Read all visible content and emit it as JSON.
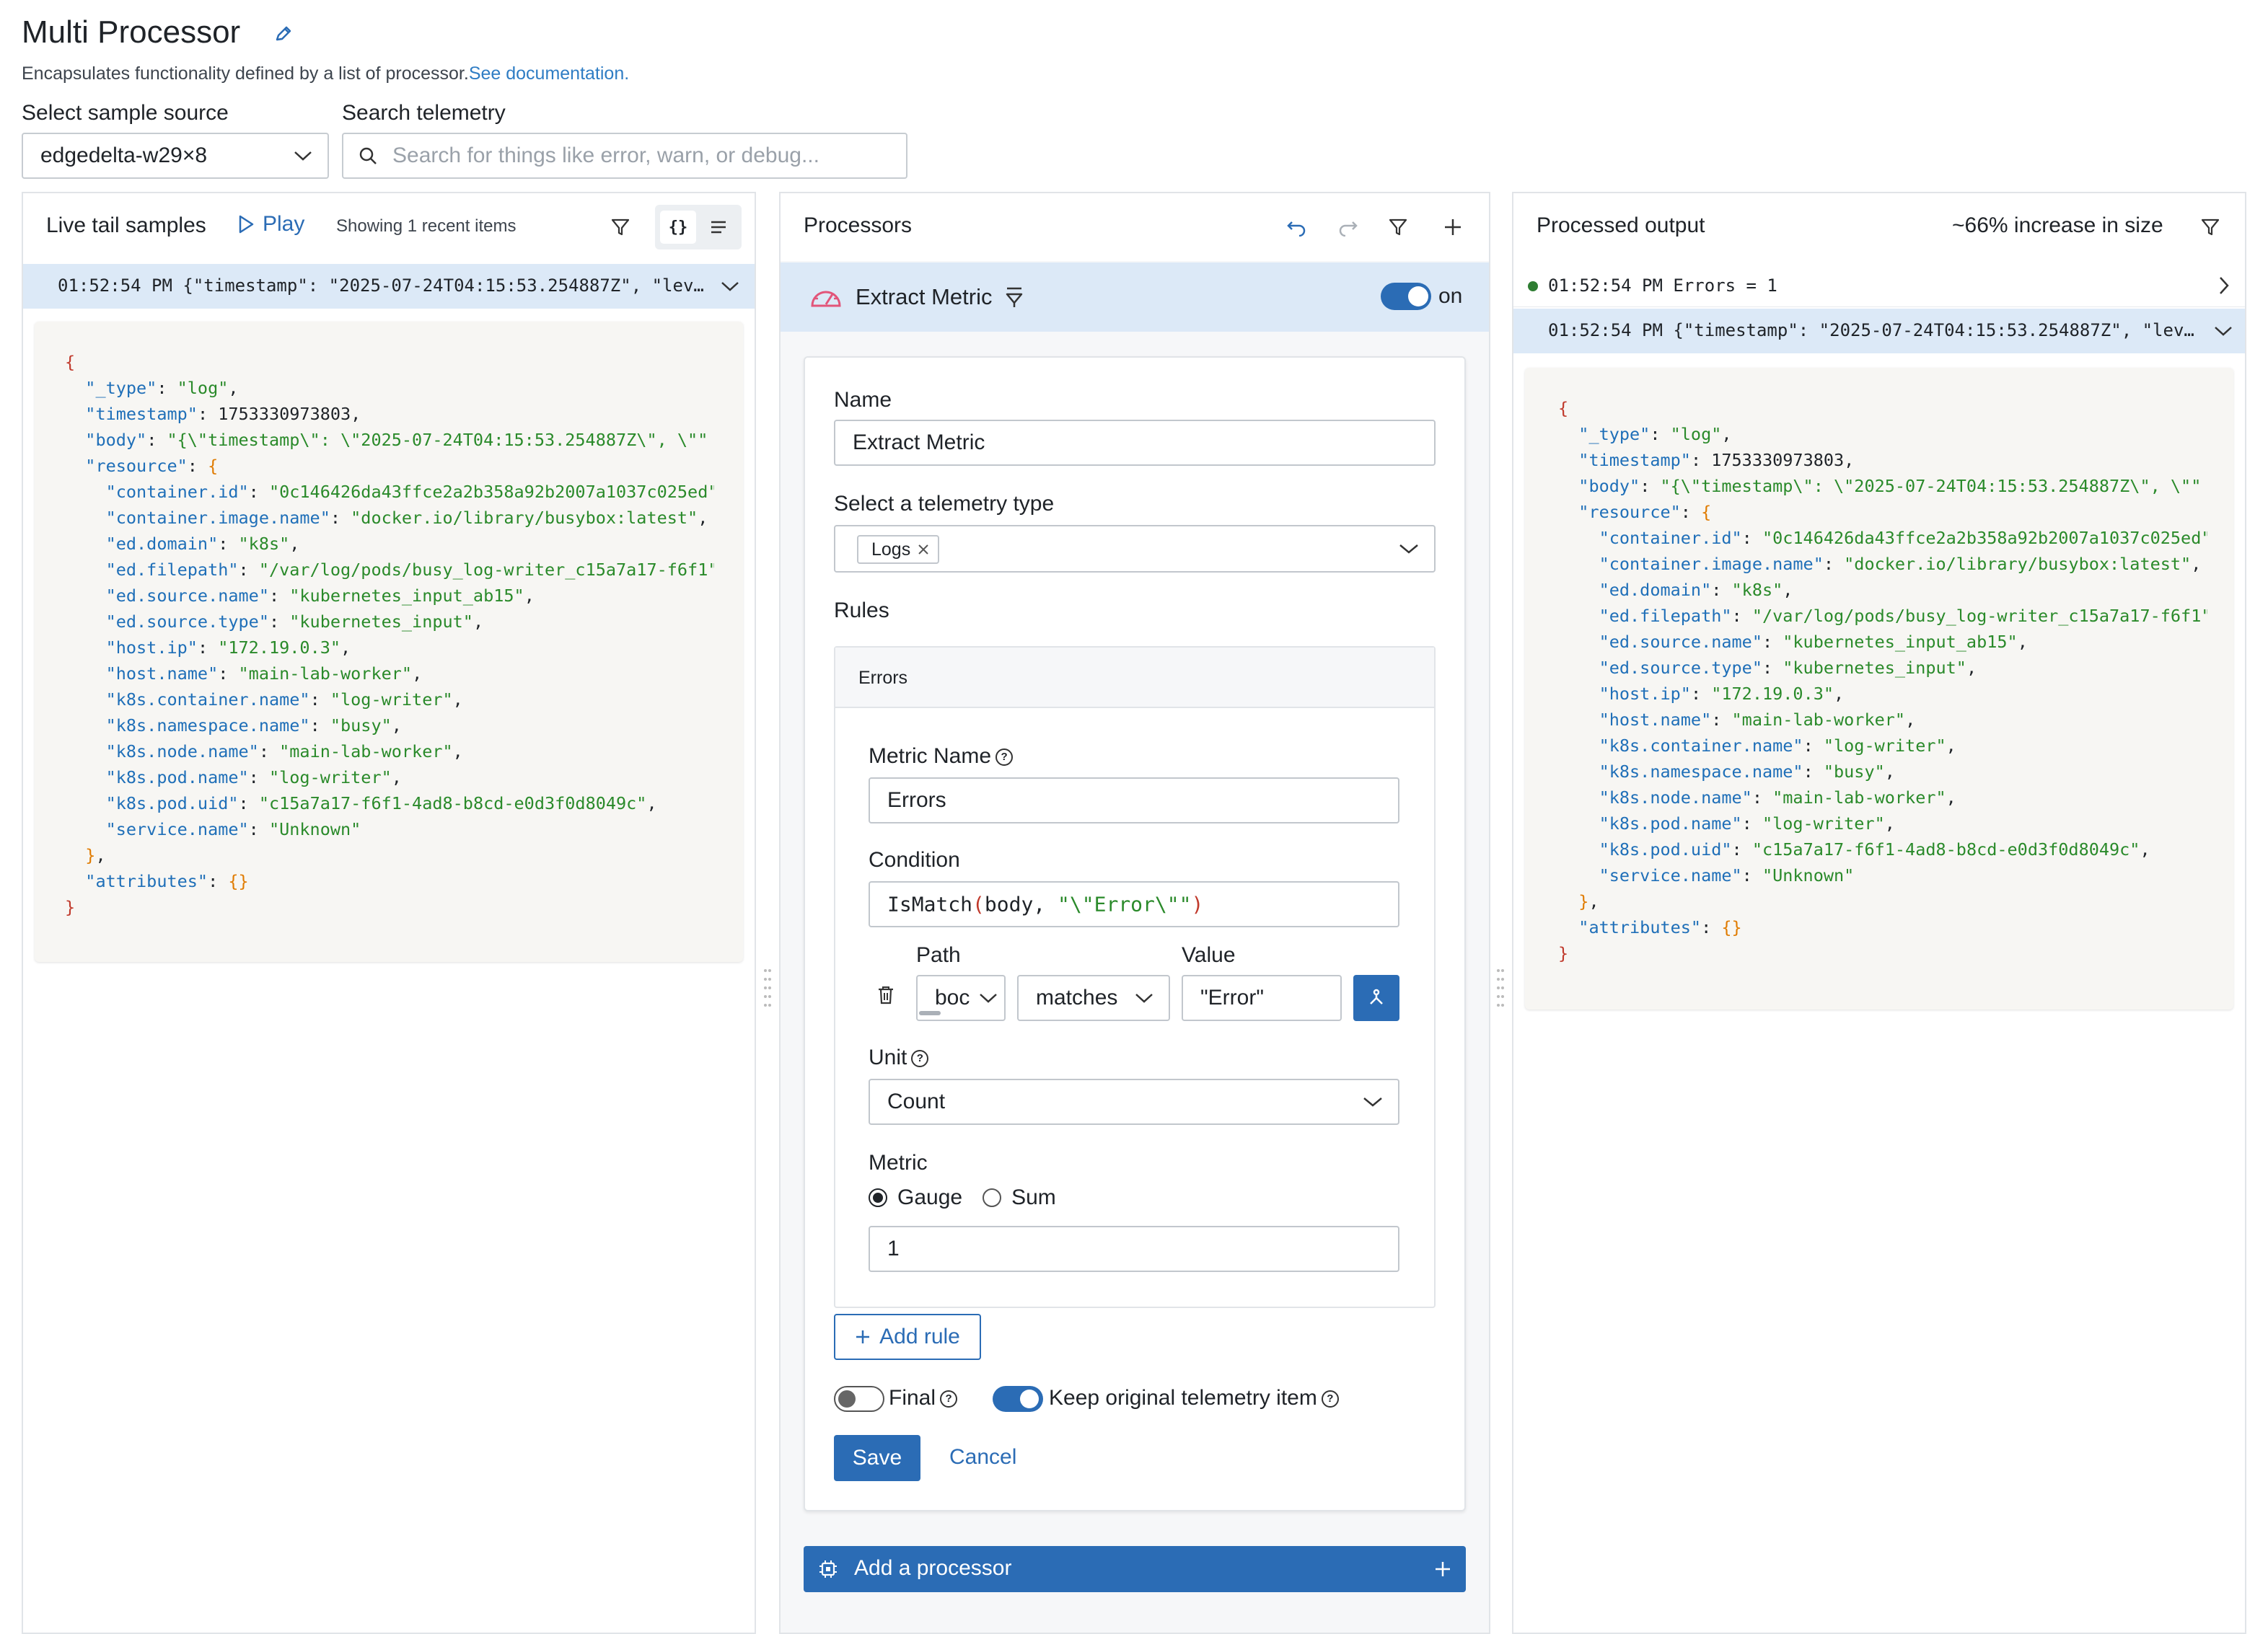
{
  "header": {
    "title": "Multi Processor",
    "subtitle": "Encapsulates functionality defined by a list of processor.",
    "doc_link": "See documentation.",
    "sample_source_label": "Select sample source",
    "sample_source_value": "edgedelta-w29×8",
    "search_label": "Search telemetry",
    "search_placeholder": "Search for things like error, warn, or debug..."
  },
  "live_tail": {
    "title": "Live tail samples",
    "play_label": "Play",
    "showing_text": "Showing 1 recent items",
    "log_line": "01:52:54 PM {\"timestamp\": \"2025-07-24T04:15:53.254887Z\", \"lev…",
    "json_lines": [
      [
        {
          "t": "b",
          "v": "{"
        }
      ],
      [
        {
          "t": "n",
          "v": "  "
        },
        {
          "t": "k",
          "v": "\"_type\""
        },
        {
          "t": "n",
          "v": ": "
        },
        {
          "t": "s",
          "v": "\"log\""
        },
        {
          "t": "n",
          "v": ","
        }
      ],
      [
        {
          "t": "n",
          "v": "  "
        },
        {
          "t": "k",
          "v": "\"timestamp\""
        },
        {
          "t": "n",
          "v": ": 1753330973803,"
        }
      ],
      [
        {
          "t": "n",
          "v": "  "
        },
        {
          "t": "k",
          "v": "\"body\""
        },
        {
          "t": "n",
          "v": ": "
        },
        {
          "t": "s",
          "v": "\"{\\\"timestamp\\\": \\\"2025-07-24T04:15:53.254887Z\\\", \\\"\""
        }
      ],
      [
        {
          "t": "n",
          "v": "  "
        },
        {
          "t": "k",
          "v": "\"resource\""
        },
        {
          "t": "n",
          "v": ": "
        },
        {
          "t": "o",
          "v": "{"
        }
      ],
      [
        {
          "t": "n",
          "v": "    "
        },
        {
          "t": "k",
          "v": "\"container.id\""
        },
        {
          "t": "n",
          "v": ": "
        },
        {
          "t": "s",
          "v": "\"0c146426da43ffce2a2b358a92b2007a1037c025ed\""
        }
      ],
      [
        {
          "t": "n",
          "v": "    "
        },
        {
          "t": "k",
          "v": "\"container.image.name\""
        },
        {
          "t": "n",
          "v": ": "
        },
        {
          "t": "s",
          "v": "\"docker.io/library/busybox:latest\""
        },
        {
          "t": "n",
          "v": ","
        }
      ],
      [
        {
          "t": "n",
          "v": "    "
        },
        {
          "t": "k",
          "v": "\"ed.domain\""
        },
        {
          "t": "n",
          "v": ": "
        },
        {
          "t": "s",
          "v": "\"k8s\""
        },
        {
          "t": "n",
          "v": ","
        }
      ],
      [
        {
          "t": "n",
          "v": "    "
        },
        {
          "t": "k",
          "v": "\"ed.filepath\""
        },
        {
          "t": "n",
          "v": ": "
        },
        {
          "t": "s",
          "v": "\"/var/log/pods/busy_log-writer_c15a7a17-f6f1\""
        }
      ],
      [
        {
          "t": "n",
          "v": "    "
        },
        {
          "t": "k",
          "v": "\"ed.source.name\""
        },
        {
          "t": "n",
          "v": ": "
        },
        {
          "t": "s",
          "v": "\"kubernetes_input_ab15\""
        },
        {
          "t": "n",
          "v": ","
        }
      ],
      [
        {
          "t": "n",
          "v": "    "
        },
        {
          "t": "k",
          "v": "\"ed.source.type\""
        },
        {
          "t": "n",
          "v": ": "
        },
        {
          "t": "s",
          "v": "\"kubernetes_input\""
        },
        {
          "t": "n",
          "v": ","
        }
      ],
      [
        {
          "t": "n",
          "v": "    "
        },
        {
          "t": "k",
          "v": "\"host.ip\""
        },
        {
          "t": "n",
          "v": ": "
        },
        {
          "t": "s",
          "v": "\"172.19.0.3\""
        },
        {
          "t": "n",
          "v": ","
        }
      ],
      [
        {
          "t": "n",
          "v": "    "
        },
        {
          "t": "k",
          "v": "\"host.name\""
        },
        {
          "t": "n",
          "v": ": "
        },
        {
          "t": "s",
          "v": "\"main-lab-worker\""
        },
        {
          "t": "n",
          "v": ","
        }
      ],
      [
        {
          "t": "n",
          "v": "    "
        },
        {
          "t": "k",
          "v": "\"k8s.container.name\""
        },
        {
          "t": "n",
          "v": ": "
        },
        {
          "t": "s",
          "v": "\"log-writer\""
        },
        {
          "t": "n",
          "v": ","
        }
      ],
      [
        {
          "t": "n",
          "v": "    "
        },
        {
          "t": "k",
          "v": "\"k8s.namespace.name\""
        },
        {
          "t": "n",
          "v": ": "
        },
        {
          "t": "s",
          "v": "\"busy\""
        },
        {
          "t": "n",
          "v": ","
        }
      ],
      [
        {
          "t": "n",
          "v": "    "
        },
        {
          "t": "k",
          "v": "\"k8s.node.name\""
        },
        {
          "t": "n",
          "v": ": "
        },
        {
          "t": "s",
          "v": "\"main-lab-worker\""
        },
        {
          "t": "n",
          "v": ","
        }
      ],
      [
        {
          "t": "n",
          "v": "    "
        },
        {
          "t": "k",
          "v": "\"k8s.pod.name\""
        },
        {
          "t": "n",
          "v": ": "
        },
        {
          "t": "s",
          "v": "\"log-writer\""
        },
        {
          "t": "n",
          "v": ","
        }
      ],
      [
        {
          "t": "n",
          "v": "    "
        },
        {
          "t": "k",
          "v": "\"k8s.pod.uid\""
        },
        {
          "t": "n",
          "v": ": "
        },
        {
          "t": "s",
          "v": "\"c15a7a17-f6f1-4ad8-b8cd-e0d3f0d8049c\""
        },
        {
          "t": "n",
          "v": ","
        }
      ],
      [
        {
          "t": "n",
          "v": "    "
        },
        {
          "t": "k",
          "v": "\"service.name\""
        },
        {
          "t": "n",
          "v": ": "
        },
        {
          "t": "s",
          "v": "\"Unknown\""
        }
      ],
      [
        {
          "t": "n",
          "v": "  "
        },
        {
          "t": "o",
          "v": "}"
        },
        {
          "t": "n",
          "v": ","
        }
      ],
      [
        {
          "t": "n",
          "v": "  "
        },
        {
          "t": "k",
          "v": "\"attributes\""
        },
        {
          "t": "n",
          "v": ": "
        },
        {
          "t": "o",
          "v": "{}"
        }
      ],
      [
        {
          "t": "b",
          "v": "}"
        }
      ]
    ]
  },
  "processors": {
    "title": "Processors",
    "processor_name": "Extract Metric",
    "toggle_label": "on",
    "name_label": "Name",
    "name_value": "Extract Metric",
    "telemetry_type_label": "Select a telemetry type",
    "telemetry_tag": "Logs",
    "rules_label": "Rules",
    "rule_title": "Errors",
    "metric_name_label": "Metric Name",
    "metric_name_value": "Errors",
    "condition_label": "Condition",
    "condition_value": "IsMatch(body, \"\\\"Error\\\"\")",
    "path_label": "Path",
    "path_value": "boc",
    "operator_value": "matches",
    "value_label": "Value",
    "value_value": "\"Error\"",
    "unit_label": "Unit",
    "unit_value": "Count",
    "metric_label": "Metric",
    "metric_options": [
      "Gauge",
      "Sum"
    ],
    "metric_selected": "Gauge",
    "metric_value": "1",
    "add_rule_label": "Add rule",
    "final_label": "Final",
    "final_on": false,
    "keep_original_label": "Keep original telemetry item",
    "keep_original_on": true,
    "save_label": "Save",
    "cancel_label": "Cancel",
    "add_processor_label": "Add a processor"
  },
  "output": {
    "title": "Processed output",
    "size_change": "~66% increase in size",
    "metric_line": "01:52:54 PM Errors = 1",
    "log_line": "01:52:54 PM {\"timestamp\": \"2025-07-24T04:15:53.254887Z\", \"lev…"
  },
  "colors": {
    "accent": "#2b6cb5",
    "link": "#2f7dc4",
    "selected_row_bg": "#dce9f7",
    "code_bg": "#f7f6f3",
    "status_dot": "#2e7d32",
    "gauge_icon": "#e2557a"
  }
}
